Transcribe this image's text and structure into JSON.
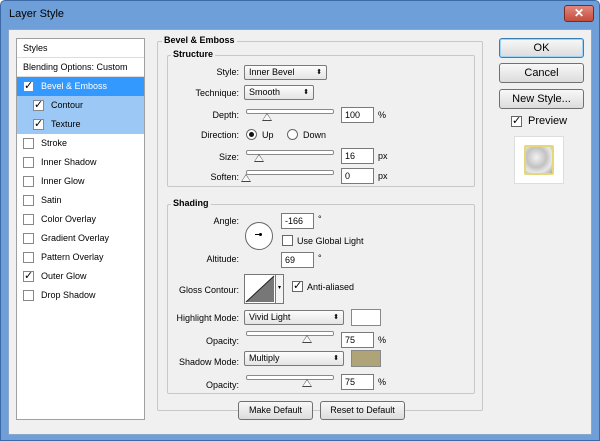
{
  "window": {
    "title": "Layer Style",
    "close_glyph": "✕"
  },
  "sidebar": {
    "header": "Styles",
    "blending": "Blending Options: Custom",
    "items": [
      {
        "label": "Bevel & Emboss",
        "checked": true
      },
      {
        "label": "Contour",
        "checked": true
      },
      {
        "label": "Texture",
        "checked": true
      },
      {
        "label": "Stroke",
        "checked": false
      },
      {
        "label": "Inner Shadow",
        "checked": false
      },
      {
        "label": "Inner Glow",
        "checked": false
      },
      {
        "label": "Satin",
        "checked": false
      },
      {
        "label": "Color Overlay",
        "checked": false
      },
      {
        "label": "Gradient Overlay",
        "checked": false
      },
      {
        "label": "Pattern Overlay",
        "checked": false
      },
      {
        "label": "Outer Glow",
        "checked": true
      },
      {
        "label": "Drop Shadow",
        "checked": false
      }
    ]
  },
  "panel": {
    "title": "Bevel & Emboss"
  },
  "structure": {
    "title": "Structure",
    "style_label": "Style:",
    "style_value": "Inner Bevel",
    "technique_label": "Technique:",
    "technique_value": "Smooth",
    "depth_label": "Depth:",
    "depth_value": "100",
    "depth_unit": "%",
    "direction_label": "Direction:",
    "dir_up": "Up",
    "dir_down": "Down",
    "size_label": "Size:",
    "size_value": "16",
    "size_unit": "px",
    "soften_label": "Soften:",
    "soften_value": "0",
    "soften_unit": "px"
  },
  "shading": {
    "title": "Shading",
    "angle_label": "Angle:",
    "angle_value": "-166",
    "angle_unit": "°",
    "global_light": "Use Global Light",
    "altitude_label": "Altitude:",
    "altitude_value": "69",
    "altitude_unit": "°",
    "gloss_label": "Gloss Contour:",
    "anti_aliased": "Anti-aliased",
    "highlight_mode_label": "Highlight Mode:",
    "highlight_mode_value": "Vivid Light",
    "highlight_color": "#ffffff",
    "h_opacity_label": "Opacity:",
    "h_opacity_value": "75",
    "h_opacity_unit": "%",
    "shadow_mode_label": "Shadow Mode:",
    "shadow_mode_value": "Multiply",
    "shadow_color": "#aea477",
    "s_opacity_label": "Opacity:",
    "s_opacity_value": "75",
    "s_opacity_unit": "%"
  },
  "footer": {
    "make_default": "Make Default",
    "reset_default": "Reset to Default"
  },
  "right": {
    "ok": "OK",
    "cancel": "Cancel",
    "new_style": "New Style...",
    "preview": "Preview",
    "preview_checked": true
  },
  "glyphs": {
    "check": "✓",
    "arrows": "⬍",
    "dd_arrow": "▾"
  }
}
